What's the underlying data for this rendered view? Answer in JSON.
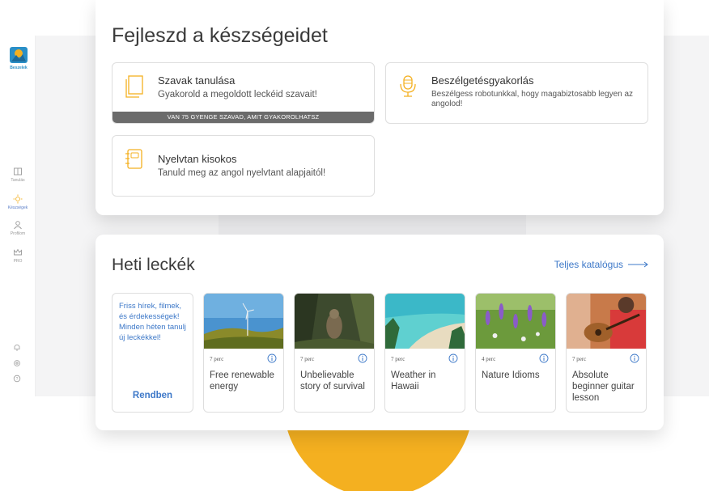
{
  "app": {
    "logo_text": "Beszelek"
  },
  "sidebar": {
    "items": [
      {
        "label": "Tanulás",
        "icon": "book-icon"
      },
      {
        "label": "Készségek",
        "icon": "sun-icon",
        "active": true
      },
      {
        "label": "Profilom",
        "icon": "user-icon"
      },
      {
        "label": "PRO",
        "icon": "crown-icon"
      }
    ],
    "bottom_icons": [
      "bell-icon",
      "gear-icon",
      "help-icon"
    ]
  },
  "skills": {
    "title": "Fejleszd a készségeidet",
    "cards": [
      {
        "title": "Szavak tanulása",
        "desc": "Gyakorold a megoldott leckéid szavait!",
        "bar": "VAN 75 GYENGE SZAVAD, AMIT GYAKOROLHATSZ",
        "icon": "notebook-icon"
      },
      {
        "title": "Beszélgetésgyakorlás",
        "desc": "Beszélgess robotunkkal, hogy magabiztosabb legyen az angolod!",
        "icon": "microphone-icon"
      },
      {
        "title": "Nyelvtan kisokos",
        "desc": "Tanuld meg az angol nyelvtant alapjaitól!",
        "icon": "grammar-book-icon"
      }
    ]
  },
  "weekly": {
    "title": "Heti leckék",
    "catalog_link": "Teljes katalógus",
    "intro_text": "Friss hírek, filmek, és érdekességek! Minden héten tanulj új leckékkel!",
    "intro_button": "Rendben",
    "lessons": [
      {
        "duration": "7 perc",
        "title": "Free renewable energy",
        "thumb": "wind-turbine"
      },
      {
        "duration": "7 perc",
        "title": "Unbelievable story of survival",
        "thumb": "forest-animal"
      },
      {
        "duration": "7 perc",
        "title": "Weather in Hawaii",
        "thumb": "beach"
      },
      {
        "duration": "4 perc",
        "title": "Nature Idioms",
        "thumb": "flowers"
      },
      {
        "duration": "7 perc",
        "title": "Absolute beginner guitar lesson",
        "thumb": "guitar"
      }
    ]
  },
  "colors": {
    "accent": "#3d78c8",
    "bar": "#6b6b6b",
    "yellow": "#f4b020"
  }
}
